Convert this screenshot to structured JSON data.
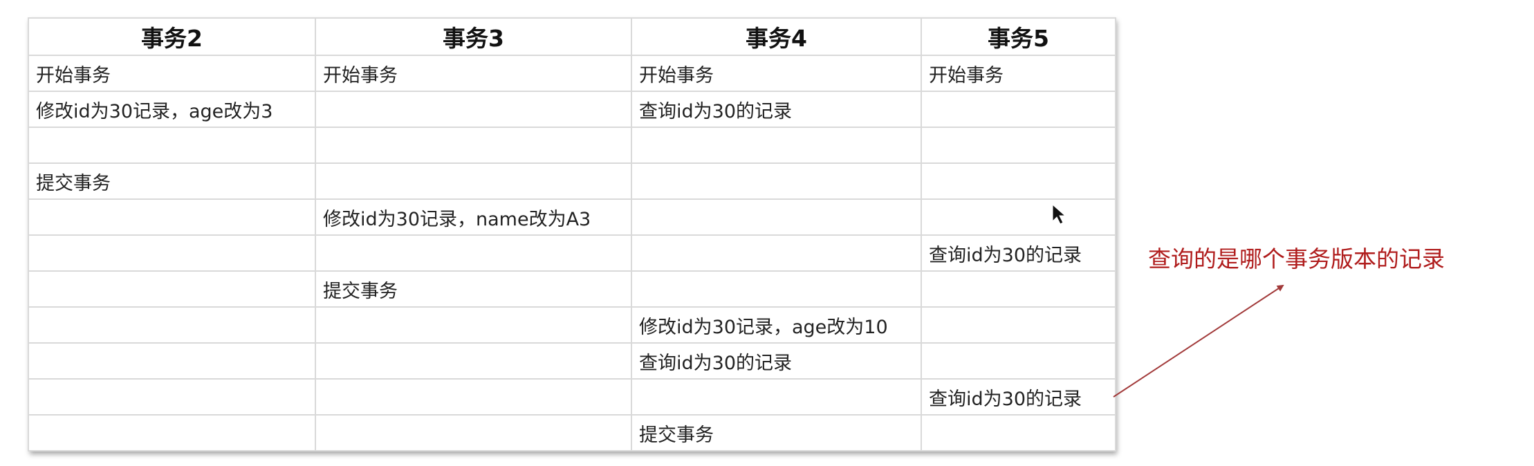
{
  "table": {
    "headers": [
      "事务2",
      "事务3",
      "事务4",
      "事务5"
    ],
    "rows": [
      [
        "开始事务",
        "开始事务",
        "开始事务",
        "开始事务"
      ],
      [
        "修改id为30记录，age改为3",
        "",
        "查询id为30的记录",
        ""
      ],
      [
        "",
        "",
        "",
        ""
      ],
      [
        "提交事务",
        "",
        "",
        ""
      ],
      [
        "",
        "修改id为30记录，name改为A3",
        "",
        ""
      ],
      [
        "",
        "",
        "",
        "查询id为30的记录"
      ],
      [
        "",
        "提交事务",
        "",
        ""
      ],
      [
        "",
        "",
        "修改id为30记录，age改为10",
        ""
      ],
      [
        "",
        "",
        "查询id为30的记录",
        ""
      ],
      [
        "",
        "",
        "",
        "查询id为30的记录"
      ],
      [
        "",
        "",
        "提交事务",
        ""
      ]
    ]
  },
  "annotation": {
    "text": "查询的是哪个事务版本的记录",
    "color": "#b01d1d"
  },
  "arrow_color": "#a23a3a"
}
